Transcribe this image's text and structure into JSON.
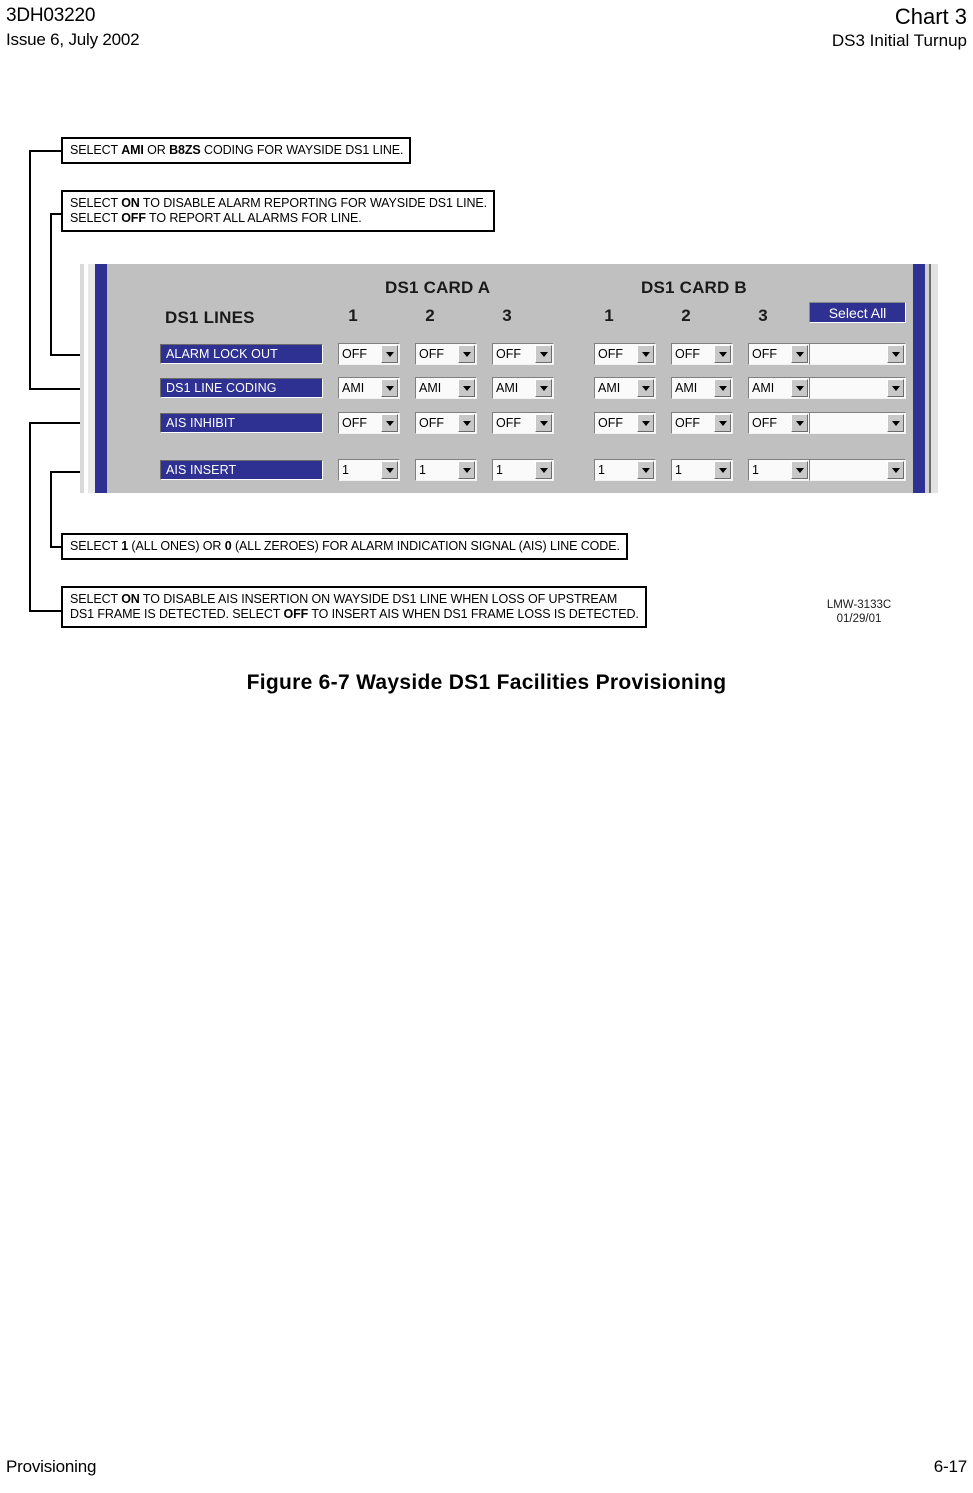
{
  "header": {
    "doc_number": "3DH03220",
    "issue": "Issue 6, July 2002",
    "chart": "Chart 3",
    "subtitle": "DS3 Initial Turnup"
  },
  "callouts": {
    "coding": {
      "line1_pre": "SELECT ",
      "line1_b1": "AMI",
      "line1_mid": " OR ",
      "line1_b2": "B8ZS",
      "line1_post": " CODING FOR WAYSIDE DS1 LINE."
    },
    "alarm_lock_out": {
      "line1_pre": "SELECT ",
      "line1_b1": "ON",
      "line1_post": " TO DISABLE ALARM REPORTING FOR WAYSIDE DS1 LINE.",
      "line2_pre": "SELECT ",
      "line2_b1": "OFF",
      "line2_post": " TO REPORT ALL ALARMS FOR LINE."
    },
    "ais_line_code": {
      "line1_pre": "SELECT ",
      "line1_b1": "1",
      "line1_mid": " (ALL ONES) OR ",
      "line1_b2": "0",
      "line1_post": " (ALL ZEROES) FOR ALARM INDICATION SIGNAL (AIS) LINE CODE."
    },
    "ais_insert": {
      "line1_pre": "SELECT ",
      "line1_b1": "ON",
      "line1_post": " TO DISABLE AIS INSERTION ON WAYSIDE DS1 LINE WHEN LOSS OF UPSTREAM",
      "line2_pre": "DS1 FRAME IS DETECTED. SELECT ",
      "line2_b1": "OFF",
      "line2_post": " TO INSERT AIS WHEN DS1 FRAME LOSS IS DETECTED."
    }
  },
  "panel": {
    "lines_header": "DS1 LINES",
    "card_a_title": "DS1 CARD A",
    "card_b_title": "DS1 CARD B",
    "column_numbers": [
      "1",
      "2",
      "3",
      "1",
      "2",
      "3"
    ],
    "select_all_label": "Select All",
    "colors": {
      "accent_blue": "#2e3192",
      "panel_gray": "#c0c0c0",
      "field_white": "#fafafa",
      "button_face": "#c8c8c8"
    },
    "rows": [
      {
        "label": "ALARM LOCK OUT",
        "values": [
          "OFF",
          "OFF",
          "OFF",
          "OFF",
          "OFF",
          "OFF"
        ],
        "select_all_value": ""
      },
      {
        "label": "DS1  LINE CODING",
        "values": [
          "AMI",
          "AMI",
          "AMI",
          "AMI",
          "AMI",
          "AMI"
        ],
        "select_all_value": ""
      },
      {
        "label": "AIS INHIBIT",
        "values": [
          "OFF",
          "OFF",
          "OFF",
          "OFF",
          "OFF",
          "OFF"
        ],
        "select_all_value": ""
      },
      {
        "label": "AIS INSERT",
        "values": [
          "1",
          "1",
          "1",
          "1",
          "1",
          "1"
        ],
        "select_all_value": ""
      }
    ]
  },
  "drawing": {
    "number": "LMW-3133C",
    "date": "01/29/01"
  },
  "figure_caption": "Figure 6-7  Wayside  DS1 Facilities Provisioning",
  "footer": {
    "section": "Provisioning",
    "page": "6-17"
  }
}
